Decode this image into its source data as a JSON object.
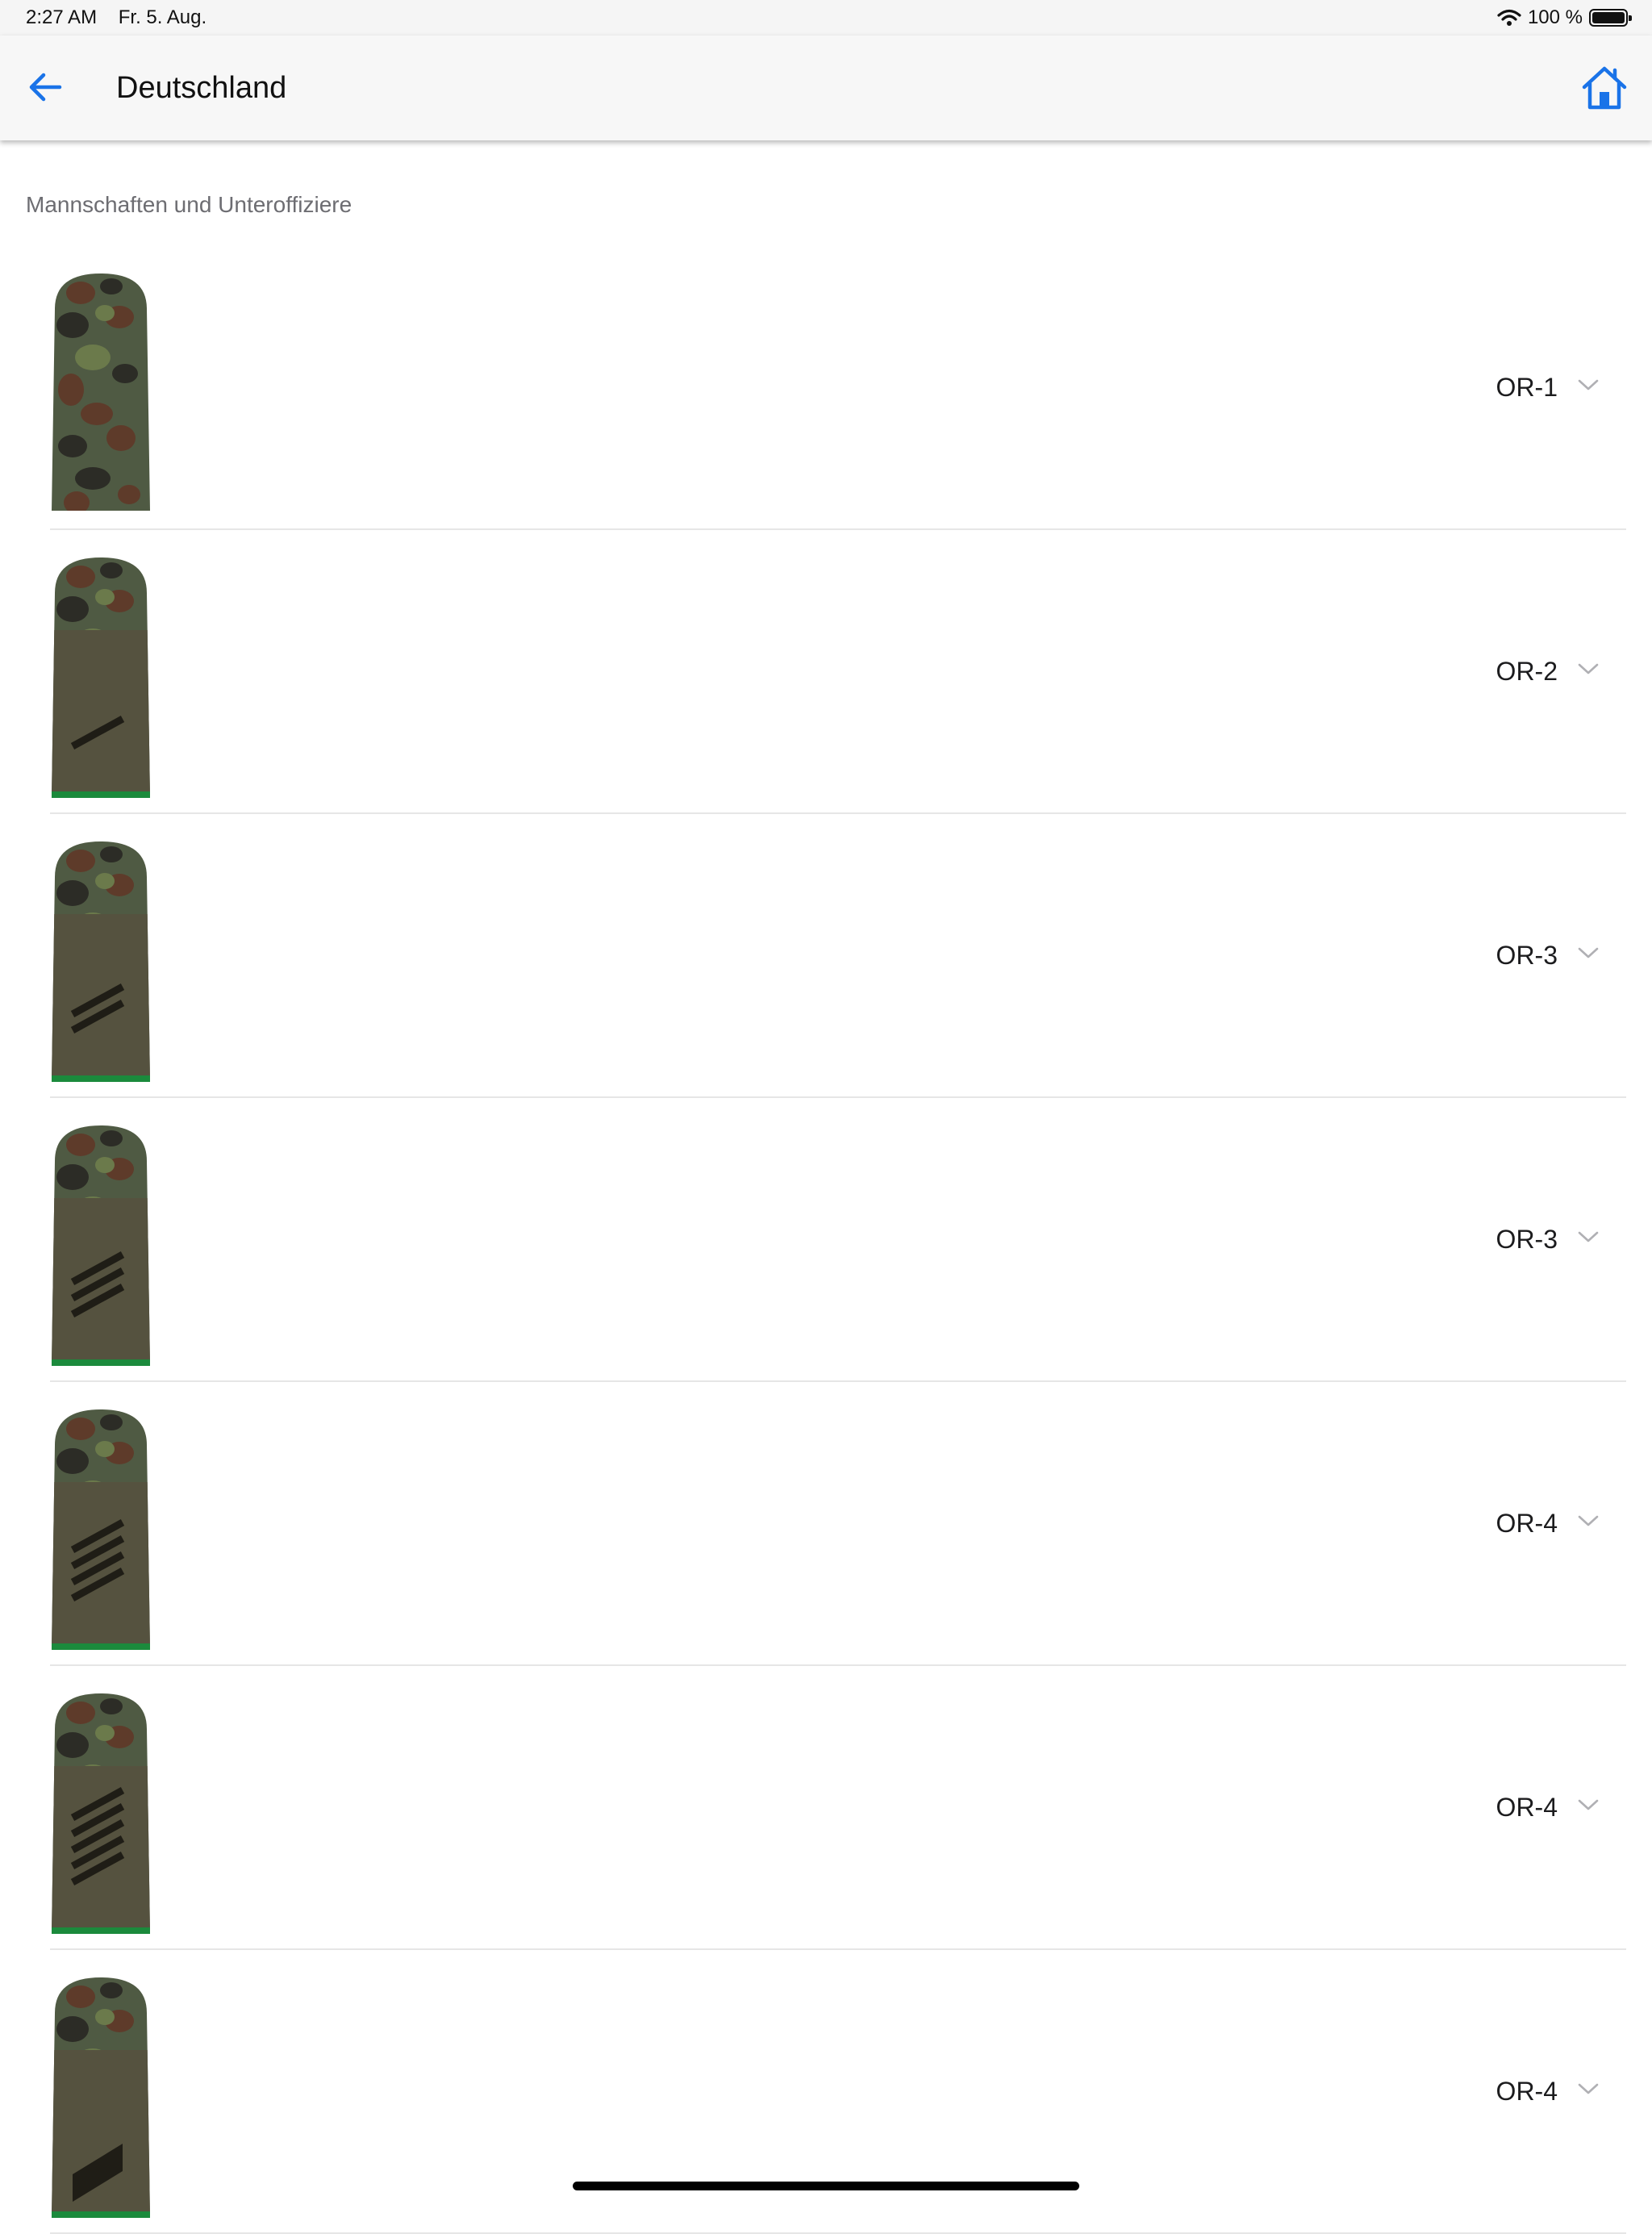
{
  "status_bar": {
    "time": "2:27 AM",
    "date": "Fr. 5. Aug.",
    "battery": "100 %"
  },
  "nav": {
    "title": "Deutschland",
    "back_icon": "arrow-left-icon",
    "home_icon": "home-icon",
    "accent_color": "#1a73e8"
  },
  "section": {
    "title": "Mannschaften und Unteroffiziere"
  },
  "ranks": [
    {
      "label": "OR-1",
      "stripes": 0,
      "sleeve": false,
      "green_border": false
    },
    {
      "label": "OR-2",
      "stripes": 1,
      "sleeve": true,
      "green_border": true
    },
    {
      "label": "OR-3",
      "stripes": 2,
      "sleeve": true,
      "green_border": true
    },
    {
      "label": "OR-3",
      "stripes": 3,
      "sleeve": true,
      "green_border": true
    },
    {
      "label": "OR-4",
      "stripes": 4,
      "sleeve": true,
      "green_border": true
    },
    {
      "label": "OR-4",
      "stripes": 5,
      "sleeve": true,
      "green_border": true
    },
    {
      "label": "OR-4",
      "stripes": 0,
      "block": true,
      "sleeve": true,
      "green_border": true
    }
  ],
  "colors": {
    "camo_base": "#4f5a43",
    "camo_brown": "#5e3b2a",
    "camo_dark": "#2c2c26",
    "camo_green": "#6b7a4b",
    "sleeve": "#55523f",
    "stripe": "#1f1d16",
    "border_green": "#1b8a3c"
  }
}
